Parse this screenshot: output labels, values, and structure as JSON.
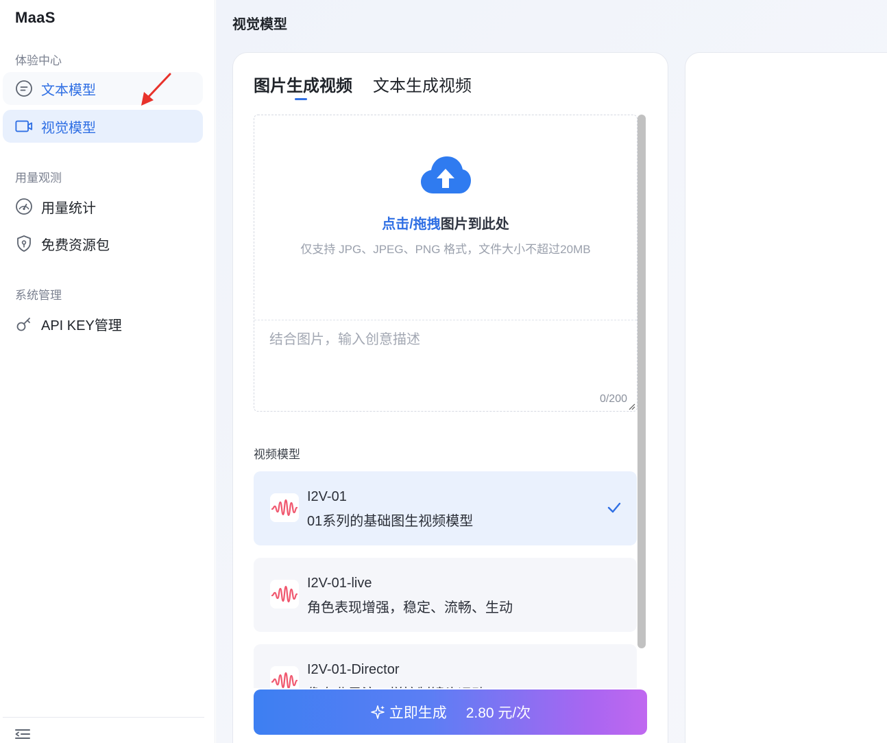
{
  "app": {
    "brand": "MaaS"
  },
  "sidebar": {
    "sections": [
      {
        "title": "体验中心",
        "items": [
          {
            "label": "文本模型",
            "icon": "chat-bubble-icon"
          },
          {
            "label": "视觉模型",
            "icon": "video-camera-icon"
          }
        ]
      },
      {
        "title": "用量观测",
        "items": [
          {
            "label": "用量统计",
            "icon": "gauge-icon"
          },
          {
            "label": "免费资源包",
            "icon": "shield-icon"
          }
        ]
      },
      {
        "title": "系统管理",
        "items": [
          {
            "label": "API KEY管理",
            "icon": "key-icon"
          }
        ]
      }
    ],
    "active_item": "视觉模型"
  },
  "main": {
    "title": "视觉模型",
    "tabs": [
      {
        "label": "图片生成视频",
        "active": true
      },
      {
        "label": "文本生成视频",
        "active": false
      }
    ],
    "upload": {
      "title_link": "点击/拖拽",
      "title_rest": "图片到此处",
      "hint": "仅支持 JPG、JPEG、PNG 格式，文件大小不超过20MB"
    },
    "prompt": {
      "placeholder": "结合图片，输入创意描述",
      "counter": "0/200"
    },
    "model_section_label": "视频模型",
    "models": [
      {
        "name": "I2V-01",
        "desc": "01系列的基础图生视频模型",
        "selected": true
      },
      {
        "name": "I2V-01-live",
        "desc": "角色表现增强，稳定、流畅、生动",
        "selected": false
      },
      {
        "name": "I2V-01-Director",
        "desc": "像专业导演一样控制镜头运动",
        "selected": false
      }
    ],
    "generate": {
      "label": "立即生成",
      "price": "2.80 元/次"
    }
  },
  "colors": {
    "accent": "#2f6fe4",
    "active_bg": "#e8f0fd",
    "button_start": "#3d7ff2",
    "button_end": "#c068f0",
    "annotation_arrow": "#e8322b"
  }
}
